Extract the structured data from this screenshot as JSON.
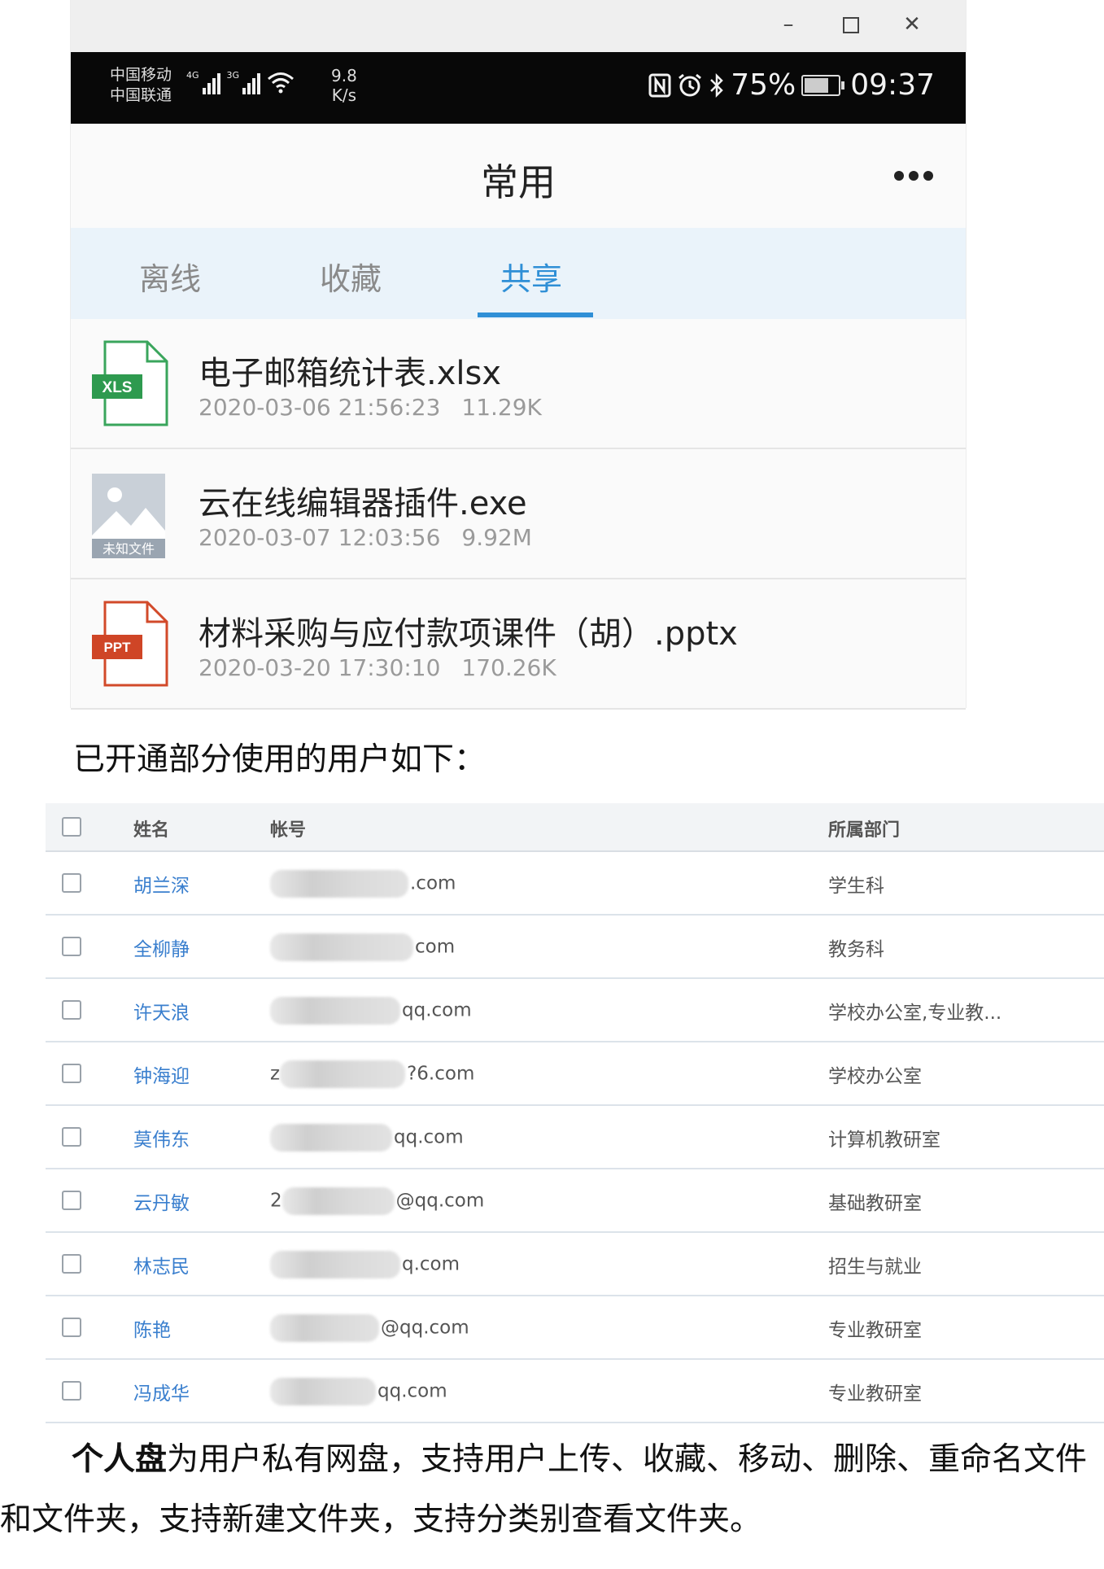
{
  "window": {
    "controls": {
      "minimize": "–",
      "close": "✕"
    }
  },
  "status_bar": {
    "carrier_1": "中国移动",
    "carrier_2": "中国联通",
    "net_1": "4G",
    "net_2": "3G",
    "speed_value": "9.8",
    "speed_unit": "K/s",
    "battery": "75%",
    "battery_level": 0.75,
    "time": "09:37"
  },
  "app": {
    "title": "常用",
    "tabs": [
      {
        "label": "离线",
        "active": false
      },
      {
        "label": "收藏",
        "active": false
      },
      {
        "label": "共享",
        "active": true
      }
    ],
    "accent_color": "#2f8fd6",
    "files": [
      {
        "name": "电子邮箱统计表.xlsx",
        "date": "2020-03-06 21:56:23",
        "size": "11.29K",
        "icon": "xls-file-icon",
        "badge": "XLS"
      },
      {
        "name": "云在线编辑器插件.exe",
        "date": "2020-03-07 12:03:56",
        "size": "9.92M",
        "icon": "unknown-file-icon",
        "badge": "未知文件"
      },
      {
        "name": "材料采购与应付款项课件（胡）.pptx",
        "date": "2020-03-20 17:30:10",
        "size": "170.26K",
        "icon": "ppt-file-icon",
        "badge": "PPT"
      }
    ]
  },
  "intro_text": "已开通部分使用的用户如下：",
  "user_table": {
    "headers": {
      "name": "姓名",
      "account": "帐号",
      "department": "所属部门"
    },
    "rows": [
      {
        "name": "胡兰深",
        "account_prefix": "",
        "account_suffix": ".com",
        "department": "学生科"
      },
      {
        "name": "全柳静",
        "account_prefix": "",
        "account_suffix": "com",
        "department": "教务科"
      },
      {
        "name": "许天浪",
        "account_prefix": "",
        "account_suffix": "qq.com",
        "department": "学校办公室,专业教..."
      },
      {
        "name": "钟海迎",
        "account_prefix": "z",
        "account_suffix": "?6.com",
        "department": "学校办公室"
      },
      {
        "name": "莫伟东",
        "account_prefix": "",
        "account_suffix": "qq.com",
        "department": "计算机教研室"
      },
      {
        "name": "云丹敏",
        "account_prefix": "2",
        "account_suffix": "@qq.com",
        "department": "基础教研室"
      },
      {
        "name": "林志民",
        "account_prefix": "",
        "account_suffix": "q.com",
        "department": "招生与就业"
      },
      {
        "name": "陈艳",
        "account_prefix": "",
        "account_suffix": "@qq.com",
        "department": "专业教研室"
      },
      {
        "name": "冯成华",
        "account_prefix": "",
        "account_suffix": "qq.com",
        "department": "专业教研室"
      }
    ]
  },
  "paragraph": {
    "bold": "个人盘",
    "rest": "为用户私有网盘，支持用户上传、收藏、移动、删除、重命名文件和文件夹，支持新建文件夹，支持分类别查看文件夹。"
  }
}
